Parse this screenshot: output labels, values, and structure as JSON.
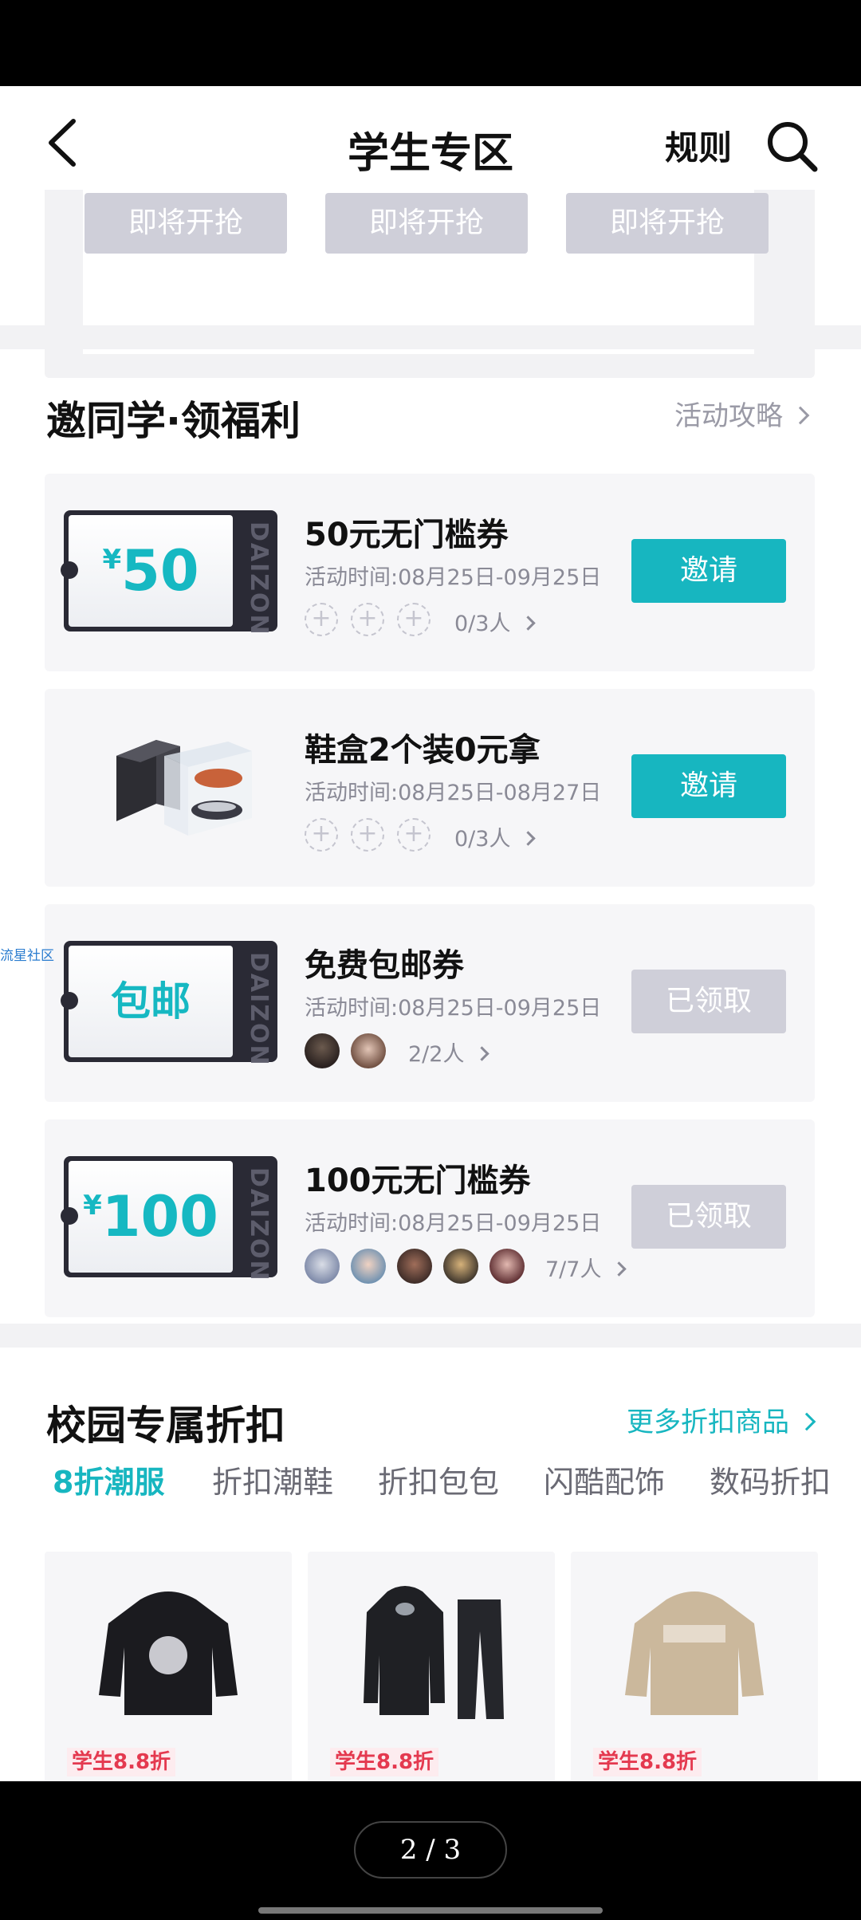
{
  "header": {
    "title": "学生专区",
    "rule_label": "规则"
  },
  "seckill": {
    "buttons": [
      "即将开抢",
      "即将开抢",
      "即将开抢"
    ]
  },
  "invite": {
    "title": "邀同学·领福利",
    "link": "活动攻略",
    "cards": [
      {
        "coupon_currency": "¥",
        "coupon_value": "50",
        "title": "50元无门槛券",
        "time": "活动时间:08月25日-09月25日",
        "count": "0/3人",
        "button": "邀请",
        "state": "active"
      },
      {
        "title": "鞋盒2个装0元拿",
        "time": "活动时间:08月25日-08月27日",
        "count": "0/3人",
        "button": "邀请",
        "state": "active"
      },
      {
        "coupon_text": "包邮",
        "title": "免费包邮券",
        "time": "活动时间:08月25日-09月25日",
        "count": "2/2人",
        "button": "已领取",
        "state": "done"
      },
      {
        "coupon_currency": "¥",
        "coupon_value": "100",
        "title": "100元无门槛券",
        "time": "活动时间:08月25日-09月25日",
        "count": "7/7人",
        "button": "已领取",
        "state": "done"
      }
    ],
    "coupon_brand": "DAIZON"
  },
  "side_tag": "流星社区",
  "discount": {
    "title": "校园专属折扣",
    "link": "更多折扣商品",
    "tabs": [
      "8折潮服",
      "折扣潮鞋",
      "折扣包包",
      "闪酷配饰",
      "数码折扣"
    ],
    "products": [
      {
        "badge": "学生8.8折",
        "icon": "black-hoodie"
      },
      {
        "badge": "学生8.8折",
        "icon": "black-jacket-pants"
      },
      {
        "badge": "学生8.8折",
        "icon": "beige-hoodie"
      }
    ]
  },
  "pager": "2 / 3",
  "colors": {
    "accent": "#17b6c0",
    "disabled": "#cfcfd9",
    "badge_red": "#e4394f"
  }
}
